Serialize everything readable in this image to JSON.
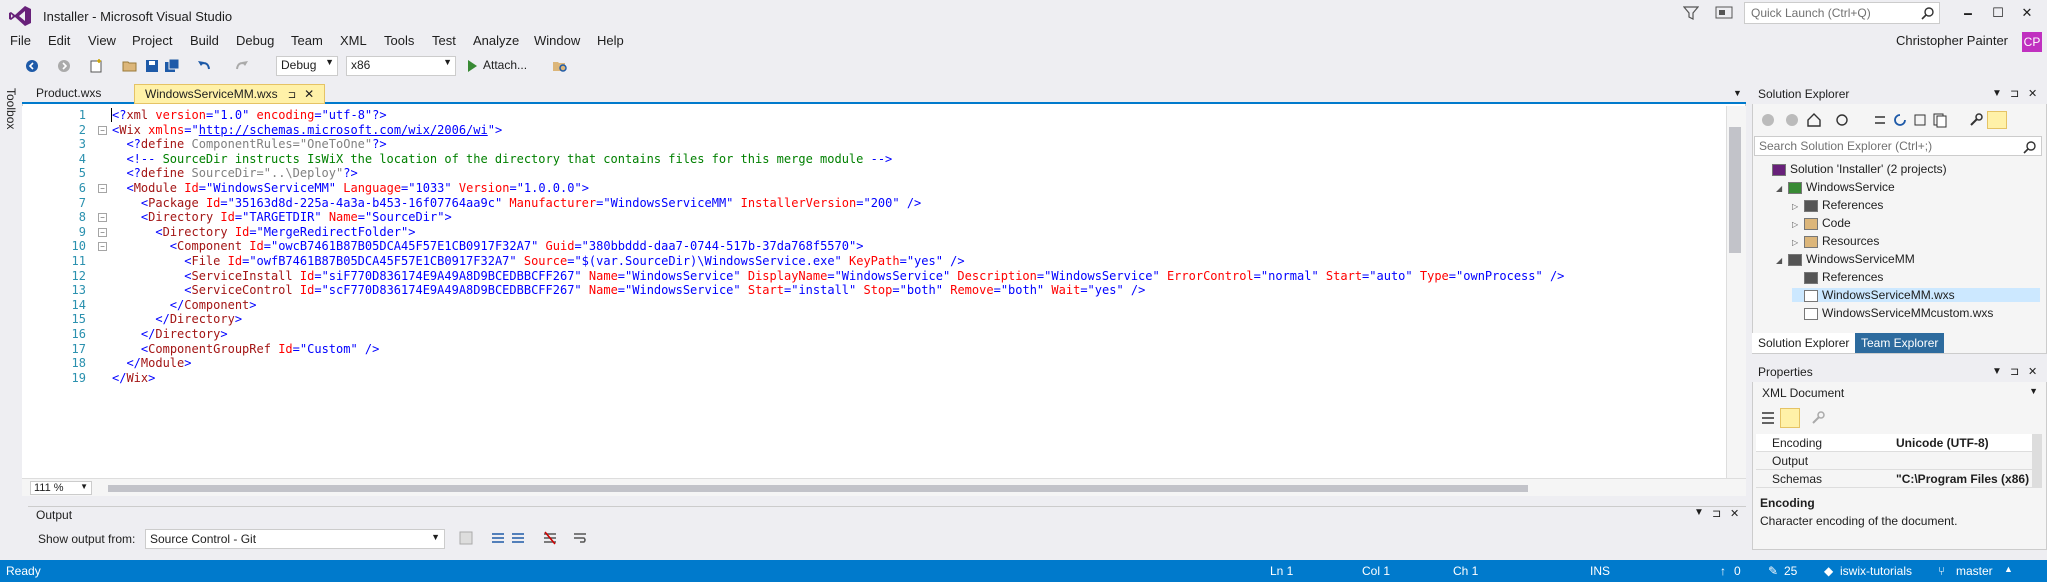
{
  "window": {
    "title": "Installer - Microsoft Visual Studio",
    "quick_launch_placeholder": "Quick Launch (Ctrl+Q)",
    "minimize": "🗕",
    "maximize": "☐",
    "close": "✕"
  },
  "menu": [
    "File",
    "Edit",
    "View",
    "Project",
    "Build",
    "Debug",
    "Team",
    "XML",
    "Tools",
    "Test",
    "Analyze",
    "Window",
    "Help"
  ],
  "user": {
    "name": "Christopher Painter",
    "initials": "CP"
  },
  "toolbar": {
    "config": "Debug",
    "platform": "x86",
    "attach": "Attach..."
  },
  "toolbox_label": "Toolbox",
  "tabs": [
    {
      "label": "Product.wxs",
      "active": false
    },
    {
      "label": "WindowsServiceMM.wxs",
      "active": true
    }
  ],
  "tab_pin": "⊐",
  "tab_close": "✕",
  "code_lines": [
    {
      "n": "1",
      "html": "<span class='d'>&lt;?</span><span class='t'>xml</span> <span class='a'>version</span><span class='d'>=</span><span class='v'>\"1.0\"</span> <span class='a'>encoding</span><span class='d'>=</span><span class='v'>\"utf-8\"</span><span class='d'>?&gt;</span>"
    },
    {
      "n": "2",
      "html": "<span class='d'>&lt;</span><span class='t'>Wix</span> <span class='a'>xmlns</span><span class='d'>=</span><span class='v'>\"<u>http://schemas.microsoft.com/wix/2006/wi</u>\"</span><span class='d'>&gt;</span>"
    },
    {
      "n": "3",
      "html": "  <span class='d'>&lt;?</span><span class='t'>define</span> <span class='g'>ComponentRules=\"OneToOne\"</span><span class='d'>?&gt;</span>"
    },
    {
      "n": "4",
      "html": "  <span class='d'>&lt;!--</span><span class='c'> SourceDir instructs IsWiX the location of the directory that contains files for this merge module </span><span class='d'>--&gt;</span>"
    },
    {
      "n": "5",
      "html": "  <span class='d'>&lt;?</span><span class='t'>define</span> <span class='g'>SourceDir=\"..\\Deploy\"</span><span class='d'>?&gt;</span>"
    },
    {
      "n": "6",
      "html": "  <span class='d'>&lt;</span><span class='t'>Module</span> <span class='a'>Id</span><span class='d'>=</span><span class='v'>\"WindowsServiceMM\"</span> <span class='a'>Language</span><span class='d'>=</span><span class='v'>\"1033\"</span> <span class='a'>Version</span><span class='d'>=</span><span class='v'>\"1.0.0.0\"</span><span class='d'>&gt;</span>"
    },
    {
      "n": "7",
      "html": "    <span class='d'>&lt;</span><span class='t'>Package</span> <span class='a'>Id</span><span class='d'>=</span><span class='v'>\"35163d8d-225a-4a3a-b453-16f07764aa9c\"</span> <span class='a'>Manufacturer</span><span class='d'>=</span><span class='v'>\"WindowsServiceMM\"</span> <span class='a'>InstallerVersion</span><span class='d'>=</span><span class='v'>\"200\"</span> <span class='d'>/&gt;</span>"
    },
    {
      "n": "8",
      "html": "    <span class='d'>&lt;</span><span class='t'>Directory</span> <span class='a'>Id</span><span class='d'>=</span><span class='v'>\"TARGETDIR\"</span> <span class='a'>Name</span><span class='d'>=</span><span class='v'>\"SourceDir\"</span><span class='d'>&gt;</span>"
    },
    {
      "n": "9",
      "html": "      <span class='d'>&lt;</span><span class='t'>Directory</span> <span class='a'>Id</span><span class='d'>=</span><span class='v'>\"MergeRedirectFolder\"</span><span class='d'>&gt;</span>"
    },
    {
      "n": "10",
      "html": "        <span class='d'>&lt;</span><span class='t'>Component</span> <span class='a'>Id</span><span class='d'>=</span><span class='v'>\"owcB7461B87B05DCA45F57E1CB0917F32A7\"</span> <span class='a'>Guid</span><span class='d'>=</span><span class='v'>\"380bbddd-daa7-0744-517b-37da768f5570\"</span><span class='d'>&gt;</span>"
    },
    {
      "n": "11",
      "html": "          <span class='d'>&lt;</span><span class='t'>File</span> <span class='a'>Id</span><span class='d'>=</span><span class='v'>\"owfB7461B87B05DCA45F57E1CB0917F32A7\"</span> <span class='a'>Source</span><span class='d'>=</span><span class='v'>\"$(var.SourceDir)\\WindowsService.exe\"</span> <span class='a'>KeyPath</span><span class='d'>=</span><span class='v'>\"yes\"</span> <span class='d'>/&gt;</span>"
    },
    {
      "n": "12",
      "html": "          <span class='d'>&lt;</span><span class='t'>ServiceInstall</span> <span class='a'>Id</span><span class='d'>=</span><span class='v'>\"siF770D836174E9A49A8D9BCEDBBCFF267\"</span> <span class='a'>Name</span><span class='d'>=</span><span class='v'>\"WindowsService\"</span> <span class='a'>DisplayName</span><span class='d'>=</span><span class='v'>\"WindowsService\"</span> <span class='a'>Description</span><span class='d'>=</span><span class='v'>\"WindowsService\"</span> <span class='a'>ErrorControl</span><span class='d'>=</span><span class='v'>\"normal\"</span> <span class='a'>Start</span><span class='d'>=</span><span class='v'>\"auto\"</span> <span class='a'>Type</span><span class='d'>=</span><span class='v'>\"ownProcess\"</span> <span class='d'>/&gt;</span>"
    },
    {
      "n": "13",
      "html": "          <span class='d'>&lt;</span><span class='t'>ServiceControl</span> <span class='a'>Id</span><span class='d'>=</span><span class='v'>\"scF770D836174E9A49A8D9BCEDBBCFF267\"</span> <span class='a'>Name</span><span class='d'>=</span><span class='v'>\"WindowsService\"</span> <span class='a'>Start</span><span class='d'>=</span><span class='v'>\"install\"</span> <span class='a'>Stop</span><span class='d'>=</span><span class='v'>\"both\"</span> <span class='a'>Remove</span><span class='d'>=</span><span class='v'>\"both\"</span> <span class='a'>Wait</span><span class='d'>=</span><span class='v'>\"yes\"</span> <span class='d'>/&gt;</span>"
    },
    {
      "n": "14",
      "html": "        <span class='d'>&lt;/</span><span class='t'>Component</span><span class='d'>&gt;</span>"
    },
    {
      "n": "15",
      "html": "      <span class='d'>&lt;/</span><span class='t'>Directory</span><span class='d'>&gt;</span>"
    },
    {
      "n": "16",
      "html": "    <span class='d'>&lt;/</span><span class='t'>Directory</span><span class='d'>&gt;</span>"
    },
    {
      "n": "17",
      "html": "    <span class='d'>&lt;</span><span class='t'>ComponentGroupRef</span> <span class='a'>Id</span><span class='d'>=</span><span class='v'>\"Custom\"</span> <span class='d'>/&gt;</span>"
    },
    {
      "n": "18",
      "html": "  <span class='d'>&lt;/</span><span class='t'>Module</span><span class='d'>&gt;</span>"
    },
    {
      "n": "19",
      "html": "<span class='d'>&lt;/</span><span class='t'>Wix</span><span class='d'>&gt;</span>"
    }
  ],
  "zoom": "111 %",
  "output": {
    "title": "Output",
    "show_label": "Show output from:",
    "source": "Source Control - Git"
  },
  "solution_explorer": {
    "title": "Solution Explorer",
    "search_placeholder": "Search Solution Explorer (Ctrl+;)",
    "items": [
      {
        "label": "Solution 'Installer' (2 projects)",
        "indent": 0,
        "icon": "solution-icon"
      },
      {
        "label": "WindowsService",
        "indent": 1,
        "icon": "csproj-icon",
        "exp": "◢"
      },
      {
        "label": "References",
        "indent": 2,
        "icon": "references-icon",
        "exp": "▷"
      },
      {
        "label": "Code",
        "indent": 2,
        "icon": "folder-icon",
        "exp": "▷"
      },
      {
        "label": "Resources",
        "indent": 2,
        "icon": "folder-icon",
        "exp": "▷"
      },
      {
        "label": "WindowsServiceMM",
        "indent": 1,
        "icon": "wixproj-icon",
        "exp": "◢"
      },
      {
        "label": "References",
        "indent": 2,
        "icon": "references-icon",
        "exp": ""
      },
      {
        "label": "WindowsServiceMM.wxs",
        "indent": 2,
        "icon": "file-icon",
        "exp": "",
        "selected": true
      },
      {
        "label": "WindowsServiceMMcustom.wxs",
        "indent": 2,
        "icon": "file-icon",
        "exp": ""
      }
    ],
    "tabs": [
      "Solution Explorer",
      "Team Explorer"
    ]
  },
  "properties": {
    "title": "Properties",
    "object": "XML Document",
    "rows": [
      {
        "key": "Encoding",
        "value": "Unicode (UTF-8)"
      },
      {
        "key": "Output",
        "value": ""
      },
      {
        "key": "Schemas",
        "value": "\"C:\\Program Files (x86)"
      }
    ],
    "desc_title": "Encoding",
    "desc": "Character encoding of the document."
  },
  "status": {
    "ready": "Ready",
    "ln": "Ln 1",
    "col": "Col 1",
    "ch": "Ch 1",
    "ins": "INS",
    "up": "0",
    "edits": "25",
    "repo": "iswix-tutorials",
    "branch": "master"
  },
  "colors": {
    "accent": "#007acc",
    "tab_active": "#fff1a8",
    "avatar": "#c030c0"
  }
}
